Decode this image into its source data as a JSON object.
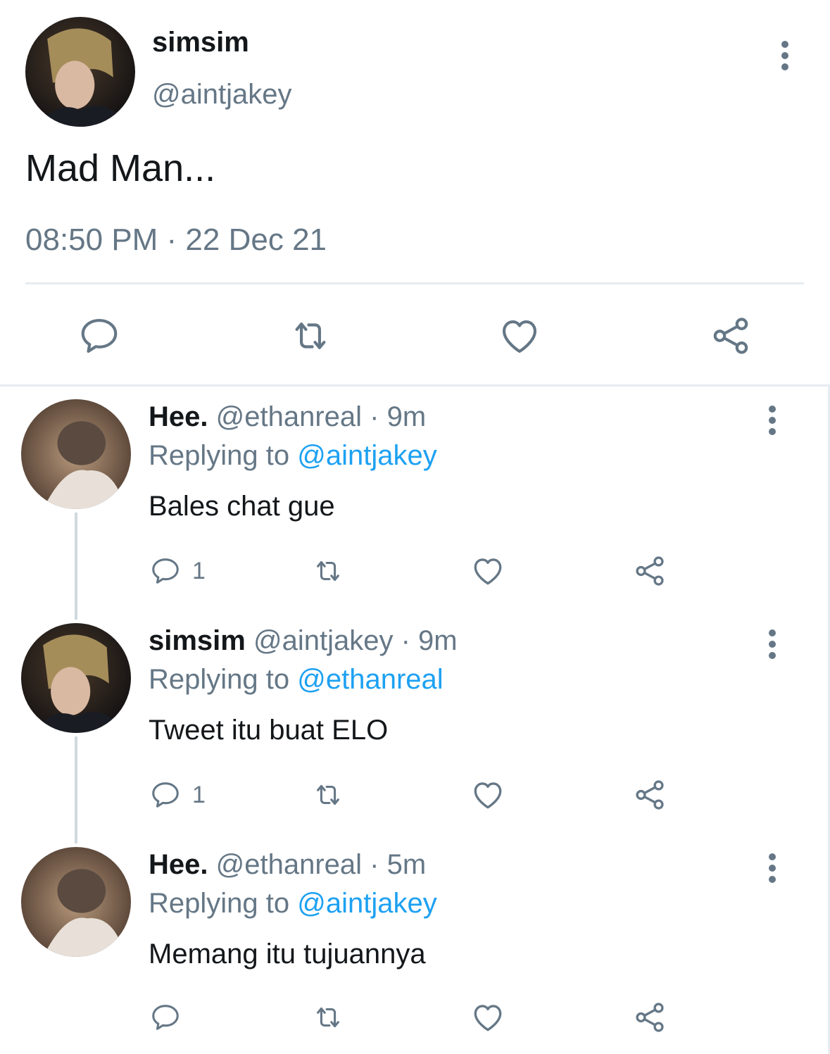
{
  "main_tweet": {
    "display_name": "simsim",
    "handle": "@aintjakey",
    "text": "Mad Man...",
    "timestamp": "08:50 PM · 22 Dec 21",
    "actions": [
      "comment-icon",
      "retweet-icon",
      "like-icon",
      "share-icon"
    ]
  },
  "replies": [
    {
      "display_name": "Hee.",
      "meta": "@ethanreal · 9m",
      "replying_label": "Replying to",
      "replying_to": "@aintjakey",
      "text": "Bales chat gue",
      "reply_count": "1"
    },
    {
      "display_name": "simsim",
      "meta": "@aintjakey · 9m",
      "replying_label": "Replying to",
      "replying_to": "@ethanreal",
      "text": "Tweet itu buat ELO",
      "reply_count": "1"
    },
    {
      "display_name": "Hee.",
      "meta": "@ethanreal · 5m",
      "replying_label": "Replying to",
      "replying_to": "@aintjakey",
      "text": "Memang itu tujuannya",
      "reply_count": ""
    }
  ],
  "colors": {
    "text_primary": "#14171a",
    "text_secondary": "#657786",
    "mention": "#1da1f2",
    "divider": "#e6ecf0"
  }
}
